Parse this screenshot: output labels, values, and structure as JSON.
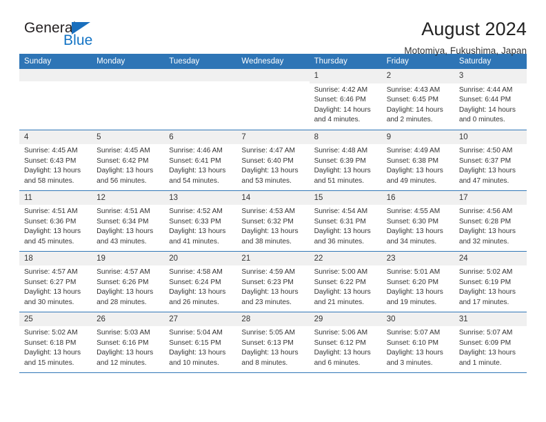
{
  "brand": {
    "name_part1": "General",
    "name_part2": "Blue"
  },
  "header": {
    "title": "August 2024",
    "subtitle": "Motomiya, Fukushima, Japan"
  },
  "colors": {
    "header_blue": "#2e75b6",
    "brand_blue": "#1273c4",
    "daynum_bg": "#f0f0f0"
  },
  "weekday_headers": [
    "Sunday",
    "Monday",
    "Tuesday",
    "Wednesday",
    "Thursday",
    "Friday",
    "Saturday"
  ],
  "weeks": [
    [
      {
        "day": "",
        "lines": []
      },
      {
        "day": "",
        "lines": []
      },
      {
        "day": "",
        "lines": []
      },
      {
        "day": "",
        "lines": []
      },
      {
        "day": "1",
        "lines": [
          "Sunrise: 4:42 AM",
          "Sunset: 6:46 PM",
          "Daylight: 14 hours",
          "and 4 minutes."
        ]
      },
      {
        "day": "2",
        "lines": [
          "Sunrise: 4:43 AM",
          "Sunset: 6:45 PM",
          "Daylight: 14 hours",
          "and 2 minutes."
        ]
      },
      {
        "day": "3",
        "lines": [
          "Sunrise: 4:44 AM",
          "Sunset: 6:44 PM",
          "Daylight: 14 hours",
          "and 0 minutes."
        ]
      }
    ],
    [
      {
        "day": "4",
        "lines": [
          "Sunrise: 4:45 AM",
          "Sunset: 6:43 PM",
          "Daylight: 13 hours",
          "and 58 minutes."
        ]
      },
      {
        "day": "5",
        "lines": [
          "Sunrise: 4:45 AM",
          "Sunset: 6:42 PM",
          "Daylight: 13 hours",
          "and 56 minutes."
        ]
      },
      {
        "day": "6",
        "lines": [
          "Sunrise: 4:46 AM",
          "Sunset: 6:41 PM",
          "Daylight: 13 hours",
          "and 54 minutes."
        ]
      },
      {
        "day": "7",
        "lines": [
          "Sunrise: 4:47 AM",
          "Sunset: 6:40 PM",
          "Daylight: 13 hours",
          "and 53 minutes."
        ]
      },
      {
        "day": "8",
        "lines": [
          "Sunrise: 4:48 AM",
          "Sunset: 6:39 PM",
          "Daylight: 13 hours",
          "and 51 minutes."
        ]
      },
      {
        "day": "9",
        "lines": [
          "Sunrise: 4:49 AM",
          "Sunset: 6:38 PM",
          "Daylight: 13 hours",
          "and 49 minutes."
        ]
      },
      {
        "day": "10",
        "lines": [
          "Sunrise: 4:50 AM",
          "Sunset: 6:37 PM",
          "Daylight: 13 hours",
          "and 47 minutes."
        ]
      }
    ],
    [
      {
        "day": "11",
        "lines": [
          "Sunrise: 4:51 AM",
          "Sunset: 6:36 PM",
          "Daylight: 13 hours",
          "and 45 minutes."
        ]
      },
      {
        "day": "12",
        "lines": [
          "Sunrise: 4:51 AM",
          "Sunset: 6:34 PM",
          "Daylight: 13 hours",
          "and 43 minutes."
        ]
      },
      {
        "day": "13",
        "lines": [
          "Sunrise: 4:52 AM",
          "Sunset: 6:33 PM",
          "Daylight: 13 hours",
          "and 41 minutes."
        ]
      },
      {
        "day": "14",
        "lines": [
          "Sunrise: 4:53 AM",
          "Sunset: 6:32 PM",
          "Daylight: 13 hours",
          "and 38 minutes."
        ]
      },
      {
        "day": "15",
        "lines": [
          "Sunrise: 4:54 AM",
          "Sunset: 6:31 PM",
          "Daylight: 13 hours",
          "and 36 minutes."
        ]
      },
      {
        "day": "16",
        "lines": [
          "Sunrise: 4:55 AM",
          "Sunset: 6:30 PM",
          "Daylight: 13 hours",
          "and 34 minutes."
        ]
      },
      {
        "day": "17",
        "lines": [
          "Sunrise: 4:56 AM",
          "Sunset: 6:28 PM",
          "Daylight: 13 hours",
          "and 32 minutes."
        ]
      }
    ],
    [
      {
        "day": "18",
        "lines": [
          "Sunrise: 4:57 AM",
          "Sunset: 6:27 PM",
          "Daylight: 13 hours",
          "and 30 minutes."
        ]
      },
      {
        "day": "19",
        "lines": [
          "Sunrise: 4:57 AM",
          "Sunset: 6:26 PM",
          "Daylight: 13 hours",
          "and 28 minutes."
        ]
      },
      {
        "day": "20",
        "lines": [
          "Sunrise: 4:58 AM",
          "Sunset: 6:24 PM",
          "Daylight: 13 hours",
          "and 26 minutes."
        ]
      },
      {
        "day": "21",
        "lines": [
          "Sunrise: 4:59 AM",
          "Sunset: 6:23 PM",
          "Daylight: 13 hours",
          "and 23 minutes."
        ]
      },
      {
        "day": "22",
        "lines": [
          "Sunrise: 5:00 AM",
          "Sunset: 6:22 PM",
          "Daylight: 13 hours",
          "and 21 minutes."
        ]
      },
      {
        "day": "23",
        "lines": [
          "Sunrise: 5:01 AM",
          "Sunset: 6:20 PM",
          "Daylight: 13 hours",
          "and 19 minutes."
        ]
      },
      {
        "day": "24",
        "lines": [
          "Sunrise: 5:02 AM",
          "Sunset: 6:19 PM",
          "Daylight: 13 hours",
          "and 17 minutes."
        ]
      }
    ],
    [
      {
        "day": "25",
        "lines": [
          "Sunrise: 5:02 AM",
          "Sunset: 6:18 PM",
          "Daylight: 13 hours",
          "and 15 minutes."
        ]
      },
      {
        "day": "26",
        "lines": [
          "Sunrise: 5:03 AM",
          "Sunset: 6:16 PM",
          "Daylight: 13 hours",
          "and 12 minutes."
        ]
      },
      {
        "day": "27",
        "lines": [
          "Sunrise: 5:04 AM",
          "Sunset: 6:15 PM",
          "Daylight: 13 hours",
          "and 10 minutes."
        ]
      },
      {
        "day": "28",
        "lines": [
          "Sunrise: 5:05 AM",
          "Sunset: 6:13 PM",
          "Daylight: 13 hours",
          "and 8 minutes."
        ]
      },
      {
        "day": "29",
        "lines": [
          "Sunrise: 5:06 AM",
          "Sunset: 6:12 PM",
          "Daylight: 13 hours",
          "and 6 minutes."
        ]
      },
      {
        "day": "30",
        "lines": [
          "Sunrise: 5:07 AM",
          "Sunset: 6:10 PM",
          "Daylight: 13 hours",
          "and 3 minutes."
        ]
      },
      {
        "day": "31",
        "lines": [
          "Sunrise: 5:07 AM",
          "Sunset: 6:09 PM",
          "Daylight: 13 hours",
          "and 1 minute."
        ]
      }
    ]
  ]
}
